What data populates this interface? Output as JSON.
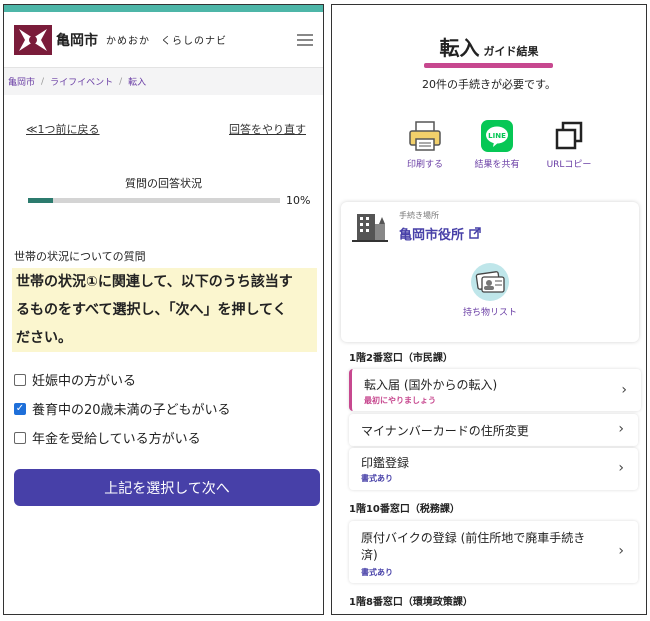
{
  "left": {
    "header": {
      "city": "亀岡市",
      "tagline": "かめおか　くらしのナビ",
      "logo_icon": "kameoka-logo-icon",
      "menu_icon": "hamburger-menu-icon"
    },
    "breadcrumb": [
      "亀岡市",
      "ライフイベント",
      "転入"
    ],
    "nav": {
      "back": "≪1つ前に戻る",
      "restart": "回答をやり直す"
    },
    "progress": {
      "label": "質問の回答状況",
      "percent_text": "10%",
      "value": 0.1
    },
    "question": {
      "section": "世帯の状況についての質問",
      "lines": [
        "世帯の状況①に関連して、以下のうち該当す",
        "るものをすべて選択し、「次へ」を押してく",
        "ださい。"
      ]
    },
    "options": [
      {
        "label": "妊娠中の方がいる",
        "checked": false
      },
      {
        "label": "養育中の20歳未満の子どもがいる",
        "checked": true
      },
      {
        "label": "年金を受給している方がいる",
        "checked": false
      }
    ],
    "submit_label": "上記を選択して次へ"
  },
  "right": {
    "title": "転入",
    "title_sub": "ガイド結果",
    "summary": "20件の手続きが必要です。",
    "accent": "#c7488f",
    "actions": [
      {
        "label": "印刷する",
        "icon": "printer-icon"
      },
      {
        "label": "結果を共有",
        "icon": "line-share-icon"
      },
      {
        "label": "URLコピー",
        "icon": "copy-icon"
      }
    ],
    "place": {
      "caption": "手続き場所",
      "name": "亀岡市役所",
      "icon": "building-icon",
      "link_icon": "external-link-icon"
    },
    "items_list_label": "持ち物リスト",
    "sections": [
      {
        "title": "1階2番窓口（市民課）",
        "rows": [
          {
            "title": "転入届 (国外からの転入)",
            "sub": "最初にやりましょう",
            "sub_color": "#c7488f"
          },
          {
            "title": "マイナンバーカードの住所変更",
            "sub": ""
          },
          {
            "title": "印鑑登録",
            "sub": "書式あり",
            "sub_color": "#4740a8"
          }
        ]
      },
      {
        "title": "1階10番窓口（税務課）",
        "rows": [
          {
            "title_lines": [
              "原付バイクの登録 (前住所地で廃車手続き",
              "済)"
            ],
            "sub": "書式あり",
            "sub_color": "#4740a8"
          }
        ]
      },
      {
        "title": "1階8番窓口（環境政策課）",
        "rows": []
      }
    ]
  }
}
